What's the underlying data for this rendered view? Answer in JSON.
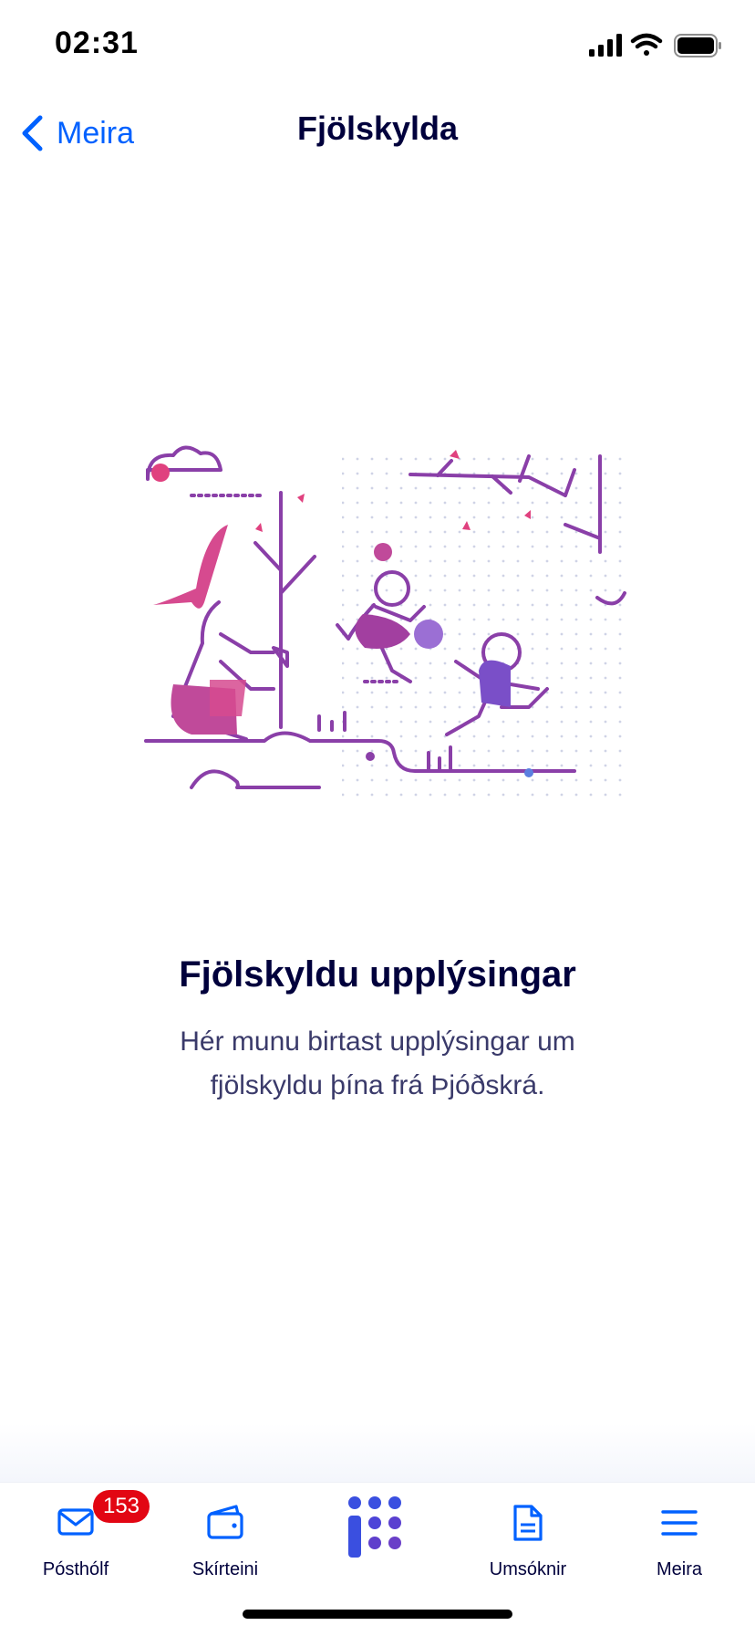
{
  "status": {
    "time": "02:31",
    "icons": [
      "cellular-signal-icon",
      "wifi-icon",
      "battery-icon"
    ]
  },
  "nav": {
    "back_label": "Meira",
    "title": "Fjölskylda"
  },
  "empty_state": {
    "illustration": "family-playing-illustration",
    "title": "Fjölskyldu upplýsingar",
    "body": "Hér munu birtast upplýsingar um fjölskyldu þína frá Þjóðskrá."
  },
  "tabbar": {
    "tabs": [
      {
        "label": "Pósthólf",
        "icon": "mail-icon",
        "badge": "153"
      },
      {
        "label": "Skírteini",
        "icon": "wallet-icon"
      },
      {
        "label": "",
        "icon": "island-logo-icon"
      },
      {
        "label": "Umsóknir",
        "icon": "document-icon"
      },
      {
        "label": "Meira",
        "icon": "menu-icon"
      }
    ]
  },
  "colors": {
    "accent": "#0061ff",
    "title": "#00003c",
    "badge": "#e20613",
    "purple": "#8a3fa8",
    "pink": "#d64a8f",
    "logo_blue": "#3a4fe0",
    "logo_purple": "#6a3fc8"
  }
}
